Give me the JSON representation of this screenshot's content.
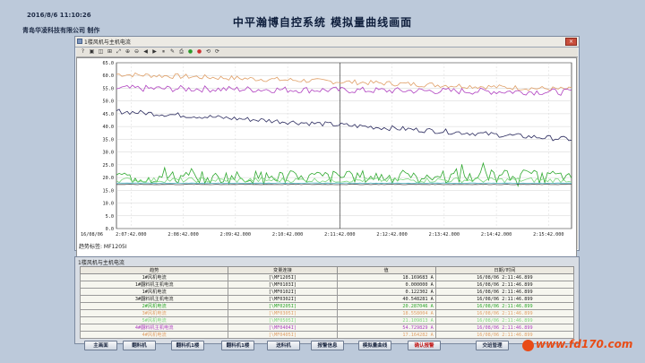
{
  "header": {
    "datetime": "2016/8/6 11:10:26",
    "company": "青岛华凌科技有限公司  制作",
    "title": "中平瀚博自控系统  模拟量曲线画面"
  },
  "window": {
    "title": "1楼风机与主机电流",
    "close": "×",
    "toolbar_icons": [
      "?",
      "▣",
      "◫",
      "⊞",
      "⤢",
      "⊕",
      "⊖",
      "◀",
      "▶",
      "⏸",
      "✎",
      "⎙",
      "●",
      "●",
      "⟲",
      "⟳"
    ],
    "footer_label": "趋势标签: MF1205I"
  },
  "chart_data": {
    "type": "line",
    "ylim": [
      0,
      65
    ],
    "yticks": [
      "0.0",
      "5.0",
      "10.0",
      "15.0",
      "20.0",
      "25.0",
      "30.0",
      "35.0",
      "40.0",
      "45.0",
      "50.0",
      "55.0",
      "60.0",
      "65.0"
    ],
    "date_label": "16/08/06",
    "xticks": [
      "2:07:42.000",
      "2:08:42.000",
      "2:09:42.000",
      "2:10:42.000",
      "2:11:42.000",
      "2:12:42.000",
      "2:13:42.000",
      "2:14:42.000",
      "2:15:42.000"
    ],
    "cursor_at": "2:11:42.000",
    "series": [
      {
        "color": "#e0a068",
        "start": 60.5,
        "end": 54.5,
        "noise": 1.0
      },
      {
        "color": "#b040c0",
        "start": 55.0,
        "end": 53.5,
        "noise": 1.3
      },
      {
        "color": "#2a2a5e",
        "start": 46.0,
        "end": 35.0,
        "noise": 1.0
      },
      {
        "color": "#2ea82e",
        "start": 20.0,
        "end": 20.5,
        "noise": 2.6
      },
      {
        "color": "#7cd87c",
        "start": 19.0,
        "end": 19.0,
        "noise": 1.0
      },
      {
        "color": "#4db6c8",
        "start": 17.8,
        "end": 17.8,
        "noise": 0.1
      },
      {
        "color": "#484848",
        "start": 17.3,
        "end": 17.3,
        "noise": 0.1
      }
    ]
  },
  "grid": {
    "title": "1楼风机与主机电流",
    "headers": [
      "趋势",
      "变量连接",
      "值",
      "日期/时间"
    ],
    "rows": [
      {
        "name": "1#风机电流",
        "tag": "[\\MF1205I]",
        "value": "18.169683 A",
        "time": "16/08/06 2:11:46.899",
        "color": "#1a1a1a"
      },
      {
        "name": "1#翻料机主机电流",
        "tag": "[\\MF0103I]",
        "value": "0.000000 A",
        "time": "16/08/06 2:11:46.899",
        "color": "#1a1a1a"
      },
      {
        "name": "1#风机电流",
        "tag": "[\\MF0102I]",
        "value": "0.122302 A",
        "time": "16/08/06 2:11:46.899",
        "color": "#1a1a1a"
      },
      {
        "name": "3#翻料机主机电流",
        "tag": "[\\MF0302I]",
        "value": "40.548281 A",
        "time": "16/08/06 2:11:46.899",
        "color": "#1a1a1a"
      },
      {
        "name": "2#风机电流",
        "tag": "[\\MF0205I]",
        "value": "20.287046 A",
        "time": "16/08/06 2:11:46.899",
        "color": "#2ea82e"
      },
      {
        "name": "3#风机电流",
        "tag": "[\\MF0305I]",
        "value": "18.558004 A",
        "time": "16/08/06 2:11:46.899",
        "color": "#e0a068"
      },
      {
        "name": "5#风机电流",
        "tag": "[\\MF0505I]",
        "value": "21.109813 A",
        "time": "16/08/06 2:11:46.899",
        "color": "#7cd87c"
      },
      {
        "name": "4#翻料机主机电流",
        "tag": "[\\MF0404I]",
        "value": "54.729829 A",
        "time": "16/08/06 2:11:46.899",
        "color": "#b040c0"
      },
      {
        "name": "4#风机电流",
        "tag": "[\\MF0405I]",
        "value": "17.164282 A",
        "time": "16/08/06 2:11:46.899",
        "color": "#e0a068"
      }
    ]
  },
  "buttons": [
    {
      "label": "主画面",
      "red": false
    },
    {
      "label": "翻料机",
      "red": false
    },
    {
      "label": "翻料机1楼",
      "red": false
    },
    {
      "label": "翻料机1楼",
      "red": false
    },
    {
      "label": "送料机",
      "red": false
    },
    {
      "label": "报警信息",
      "red": false
    },
    {
      "label": "模拟量曲线",
      "red": false
    },
    {
      "label": "确认报警",
      "red": true
    },
    {
      "label": "交班管理",
      "red": false
    }
  ],
  "watermark": "www.fd170.com"
}
